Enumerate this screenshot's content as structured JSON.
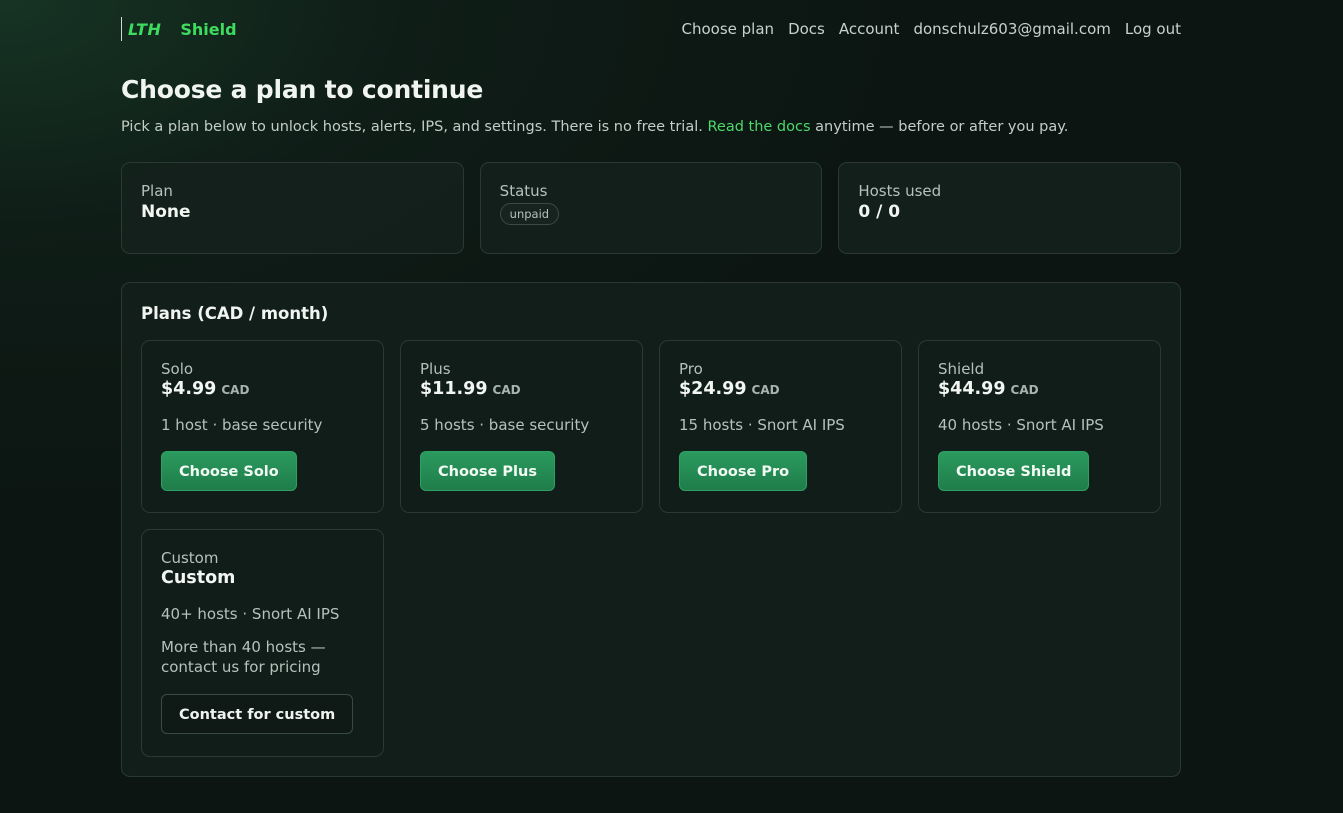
{
  "brand": {
    "lth": "LTH",
    "name": "Shield",
    "accent": "#3ddc5f"
  },
  "nav": {
    "items": [
      "Choose plan",
      "Docs",
      "Account",
      "donschulz603@gmail.com",
      "Log out"
    ]
  },
  "page": {
    "title": "Choose a plan to continue",
    "intro_before": "Pick a plan below to unlock hosts, alerts, IPS, and settings. There is no free trial. ",
    "intro_link": "Read the docs",
    "intro_after": " anytime — before or after you pay."
  },
  "stats": {
    "plan_label": "Plan",
    "plan_value": "None",
    "status_label": "Status",
    "status_value": "unpaid",
    "hosts_label": "Hosts used",
    "hosts_value": "0 / 0"
  },
  "plans": {
    "title": "Plans (CAD / month)",
    "cards": [
      {
        "name": "Solo",
        "price": "$4.99",
        "currency": "CAD",
        "desc": "1 host · base security",
        "button": "Choose Solo"
      },
      {
        "name": "Plus",
        "price": "$11.99",
        "currency": "CAD",
        "desc": "5 hosts · base security",
        "button": "Choose Plus"
      },
      {
        "name": "Pro",
        "price": "$24.99",
        "currency": "CAD",
        "desc": "15 hosts · Snort AI IPS",
        "button": "Choose Pro"
      },
      {
        "name": "Shield",
        "price": "$44.99",
        "currency": "CAD",
        "desc": "40 hosts · Snort AI IPS",
        "button": "Choose Shield"
      }
    ],
    "custom": {
      "name": "Custom",
      "title": "Custom",
      "desc": "40+ hosts · Snort AI IPS",
      "note": "More than 40 hosts — contact us for pricing",
      "button": "Contact for custom"
    }
  }
}
